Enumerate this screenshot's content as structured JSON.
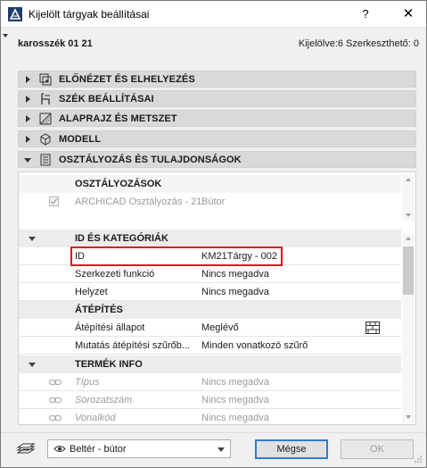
{
  "window": {
    "title": "Kijelölt tárgyak beállításai",
    "help_label": "?",
    "close_label": "✕"
  },
  "header": {
    "element_name": "karosszék 01 21",
    "selection_info": "Kijelölve:6 Szerkeszthető: 0"
  },
  "sections": [
    {
      "label": "ELŐNÉZET ÉS ELHELYEZÉS",
      "icon": "preview-placement-icon",
      "expanded": false
    },
    {
      "label": "SZÉK BEÁLLÍTÁSAI",
      "icon": "chair-settings-icon",
      "expanded": false
    },
    {
      "label": "ALAPRAJZ ÉS METSZET",
      "icon": "floorplan-section-icon",
      "expanded": false
    },
    {
      "label": "MODELL",
      "icon": "model-cube-icon",
      "expanded": false
    },
    {
      "label": "OSZTÁLYOZÁS ÉS TULAJDONSÁGOK",
      "icon": "classification-properties-icon",
      "expanded": true
    }
  ],
  "classification": {
    "title": "OSZTÁLYOZÁSOK",
    "system_label": "ARCHICAD Osztályozás - 21",
    "system_value": "Bútor"
  },
  "id_group": {
    "title": "ID ÉS KATEGÓRIÁK",
    "rows": [
      {
        "key": "ID",
        "value": "KM21Tárgy - 002"
      },
      {
        "key": "Szerkezeti funkció",
        "value": "Nincs megadva"
      },
      {
        "key": "Helyzet",
        "value": "Nincs megadva"
      }
    ]
  },
  "renovation_group": {
    "title": "ÁTÉPÍTÉS",
    "rows": [
      {
        "key": "Átépítési állapot",
        "value": "Meglévő"
      },
      {
        "key": "Mutatás átépítési szűrőb...",
        "value": "Minden vonatkozó szűrő"
      }
    ]
  },
  "product_group": {
    "title": "TERMÉK INFO",
    "rows": [
      {
        "key": "Típus",
        "value": "Nincs megadva"
      },
      {
        "key": "Sorozatszám",
        "value": "Nincs megadva"
      },
      {
        "key": "Vonalkód",
        "value": "Nincs megadva"
      }
    ]
  },
  "footer": {
    "layer_value": "Beltér - bútor",
    "cancel_label": "Mégse",
    "ok_label": "OK"
  },
  "colors": {
    "highlight": "#e3101d",
    "default_button_border": "#2f7bd6",
    "section_header": "#d9d9d9"
  }
}
